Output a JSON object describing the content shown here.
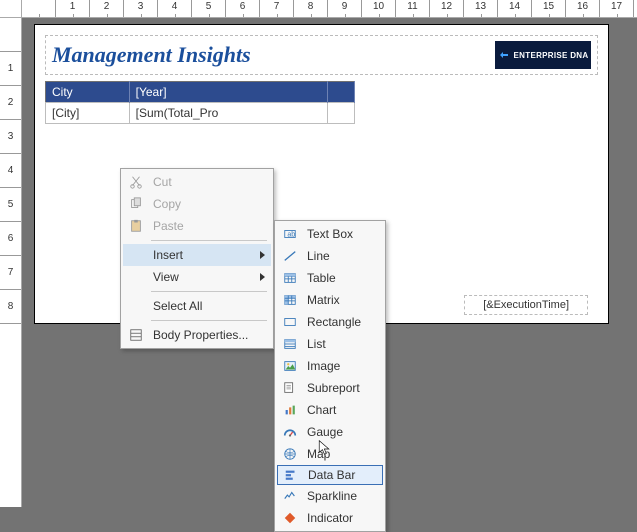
{
  "ruler_h": [
    "",
    "1",
    "2",
    "3",
    "4",
    "5",
    "6",
    "7",
    "8",
    "9",
    "10",
    "11",
    "12",
    "13",
    "14",
    "15",
    "16",
    "17"
  ],
  "ruler_v": [
    "",
    "1",
    "2",
    "3",
    "4",
    "5",
    "6",
    "7",
    "8"
  ],
  "report": {
    "title": "Management Insights",
    "logo_text": "ENTERPRISE DNA",
    "table": {
      "headers": [
        "City",
        "[Year]",
        ""
      ],
      "rows": [
        [
          "[City]",
          "[Sum(Total_Pro",
          ""
        ]
      ]
    },
    "exec_time": "[&ExecutionTime]"
  },
  "context_menu": {
    "items": [
      {
        "label": "Cut",
        "icon": "cut-icon",
        "disabled": true
      },
      {
        "label": "Copy",
        "icon": "copy-icon",
        "disabled": true
      },
      {
        "label": "Paste",
        "icon": "paste-icon",
        "disabled": true
      },
      {
        "sep": true
      },
      {
        "label": "Insert",
        "submenu": true,
        "open": true
      },
      {
        "label": "View",
        "submenu": true
      },
      {
        "sep": true
      },
      {
        "label": "Select All"
      },
      {
        "sep": true
      },
      {
        "label": "Body Properties...",
        "icon": "properties-icon"
      }
    ]
  },
  "insert_submenu": {
    "items": [
      {
        "label": "Text Box",
        "icon": "textbox-icon"
      },
      {
        "label": "Line",
        "icon": "line-icon"
      },
      {
        "label": "Table",
        "icon": "table-icon"
      },
      {
        "label": "Matrix",
        "icon": "matrix-icon"
      },
      {
        "label": "Rectangle",
        "icon": "rectangle-icon"
      },
      {
        "label": "List",
        "icon": "list-icon"
      },
      {
        "label": "Image",
        "icon": "image-icon"
      },
      {
        "label": "Subreport",
        "icon": "subreport-icon"
      },
      {
        "label": "Chart",
        "icon": "chart-icon"
      },
      {
        "label": "Gauge",
        "icon": "gauge-icon"
      },
      {
        "label": "Map",
        "icon": "map-icon"
      },
      {
        "label": "Data Bar",
        "icon": "databar-icon",
        "selected": true
      },
      {
        "label": "Sparkline",
        "icon": "sparkline-icon"
      },
      {
        "label": "Indicator",
        "icon": "indicator-icon"
      }
    ]
  }
}
